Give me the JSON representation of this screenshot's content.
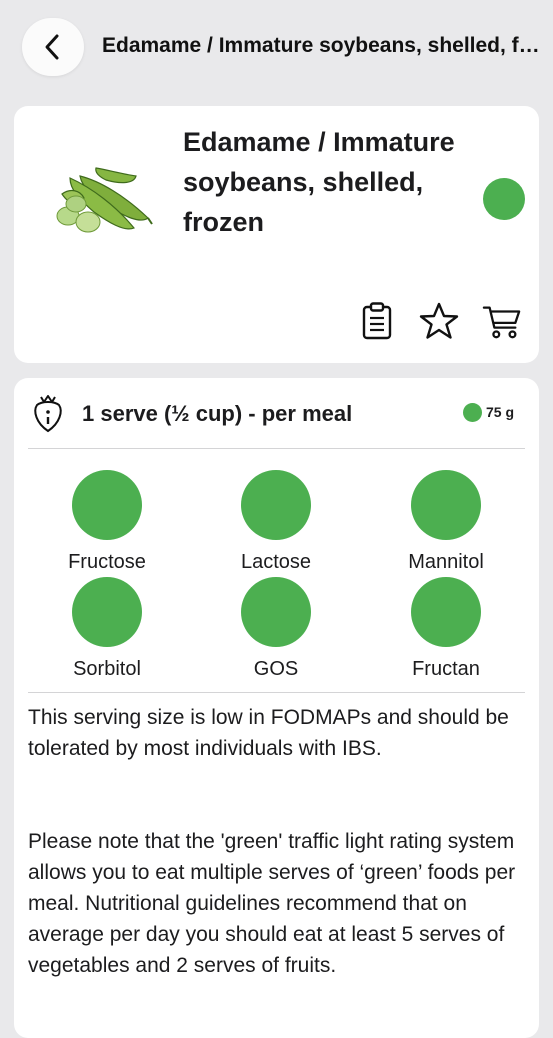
{
  "header": {
    "title": "Edamame / Immature soybeans, shelled, frozen",
    "back_icon": "chevron-left-icon"
  },
  "food": {
    "name": "Edamame / Immature soybeans, shelled, frozen",
    "rating": "green",
    "rating_color": "#4caf50",
    "actions": [
      {
        "name": "clipboard-icon"
      },
      {
        "name": "star-icon"
      },
      {
        "name": "cart-icon"
      }
    ]
  },
  "serving": {
    "label": "1 serve (½ cup) - per meal",
    "weight": "75 g",
    "weight_rating": "green",
    "icon": "strawberry-info-icon"
  },
  "nutrients": [
    {
      "name": "Fructose",
      "rating": "green"
    },
    {
      "name": "Lactose",
      "rating": "green"
    },
    {
      "name": "Mannitol",
      "rating": "green"
    },
    {
      "name": "Sorbitol",
      "rating": "green"
    },
    {
      "name": "GOS",
      "rating": "green"
    },
    {
      "name": "Fructan",
      "rating": "green"
    }
  ],
  "description": {
    "p1": "This serving size is low in FODMAPs and should be tolerated by most individuals with IBS.",
    "p2": "Please note that the 'green' traffic light rating system allows you to eat multiple serves of ‘green’ foods per meal. Nutritional guidelines recommend that on average per day you should eat at least 5 serves of vegetables and 2 serves of fruits."
  }
}
